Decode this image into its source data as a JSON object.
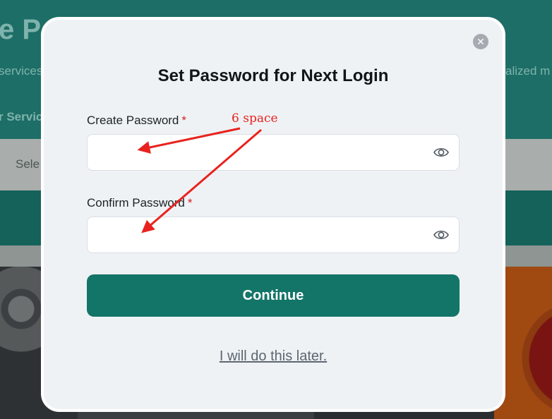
{
  "background": {
    "title": "e Pa",
    "subtitle_left": "services",
    "subtitle_right": "alized m",
    "service_label": "r Servic",
    "select_text": "Sele"
  },
  "modal": {
    "title": "Set Password for Next Login",
    "close_icon": "close-icon",
    "create_password": {
      "label": "Create Password",
      "required_mark": "*",
      "value": "",
      "icon": "eye-icon"
    },
    "confirm_password": {
      "label": "Confirm Password",
      "required_mark": "*",
      "value": "",
      "icon": "eye-icon"
    },
    "continue_label": "Continue",
    "later_link": "I will do this later.",
    "primary_color": "#137568"
  },
  "annotation": {
    "text": "6 space",
    "color": "#e8231f"
  }
}
